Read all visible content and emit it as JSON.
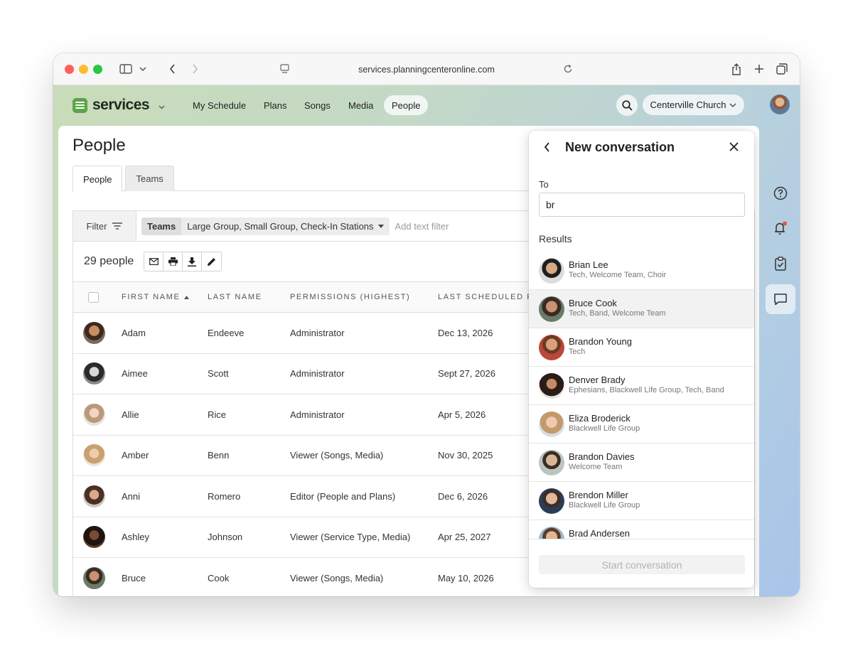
{
  "browser": {
    "url": "services.planningcenteronline.com",
    "traffic_colors": {
      "close": "#ff5f57",
      "minimize": "#febc2e",
      "zoom": "#28c840"
    }
  },
  "app": {
    "name": "services",
    "accent": "#5ba44a",
    "nav": [
      {
        "label": "My Schedule",
        "active": false
      },
      {
        "label": "Plans",
        "active": false
      },
      {
        "label": "Songs",
        "active": false
      },
      {
        "label": "Media",
        "active": false
      },
      {
        "label": "People",
        "active": true
      }
    ],
    "organization": "Centerville Church"
  },
  "page": {
    "title": "People",
    "tabs": [
      {
        "label": "People",
        "active": true
      },
      {
        "label": "Teams",
        "active": false
      }
    ],
    "filter": {
      "button_label": "Filter",
      "chip_key": "Teams",
      "chip_value": "Large Group, Small Group, Check-In Stations",
      "text_placeholder": "Add text filter"
    },
    "count_label": "29 people",
    "columns": [
      "FIRST NAME",
      "LAST NAME",
      "PERMISSIONS (HIGHEST)",
      "LAST SCHEDULED F"
    ],
    "rows": [
      {
        "first": "Adam",
        "last": "Endeeve",
        "permission": "Administrator",
        "last_scheduled": "Dec 13, 2026"
      },
      {
        "first": "Aimee",
        "last": "Scott",
        "permission": "Administrator",
        "last_scheduled": "Sept 27, 2026"
      },
      {
        "first": "Allie",
        "last": "Rice",
        "permission": "Administrator",
        "last_scheduled": "Apr 5, 2026"
      },
      {
        "first": "Amber",
        "last": "Benn",
        "permission": "Viewer (Songs, Media)",
        "last_scheduled": "Nov 30, 2025"
      },
      {
        "first": "Anni",
        "last": "Romero",
        "permission": "Editor (People and Plans)",
        "last_scheduled": "Dec 6, 2026"
      },
      {
        "first": "Ashley",
        "last": "Johnson",
        "permission": "Viewer (Service Type, Media)",
        "last_scheduled": "Apr 25, 2027"
      },
      {
        "first": "Bruce",
        "last": "Cook",
        "permission": "Viewer (Songs, Media)",
        "last_scheduled": "May 10, 2026"
      }
    ]
  },
  "conversation": {
    "title": "New conversation",
    "to_label": "To",
    "to_value": "br",
    "results_label": "Results",
    "results": [
      {
        "name": "Brian Lee",
        "teams": "Tech, Welcome Team, Choir",
        "highlighted": false
      },
      {
        "name": "Bruce Cook",
        "teams": "Tech, Band, Welcome Team",
        "highlighted": true
      },
      {
        "name": "Brandon Young",
        "teams": "Tech",
        "highlighted": false
      },
      {
        "name": "Denver Brady",
        "teams": "Ephesians, Blackwell Life Group, Tech, Band",
        "highlighted": false
      },
      {
        "name": "Eliza Broderick",
        "teams": "Blackwell Life Group",
        "highlighted": false
      },
      {
        "name": "Brandon Davies",
        "teams": "Welcome Team",
        "highlighted": false
      },
      {
        "name": "Brendon Miller",
        "teams": "Blackwell Life Group",
        "highlighted": false
      },
      {
        "name": "Brad Andersen",
        "teams": "",
        "highlighted": false
      }
    ],
    "start_label": "Start conversation"
  }
}
